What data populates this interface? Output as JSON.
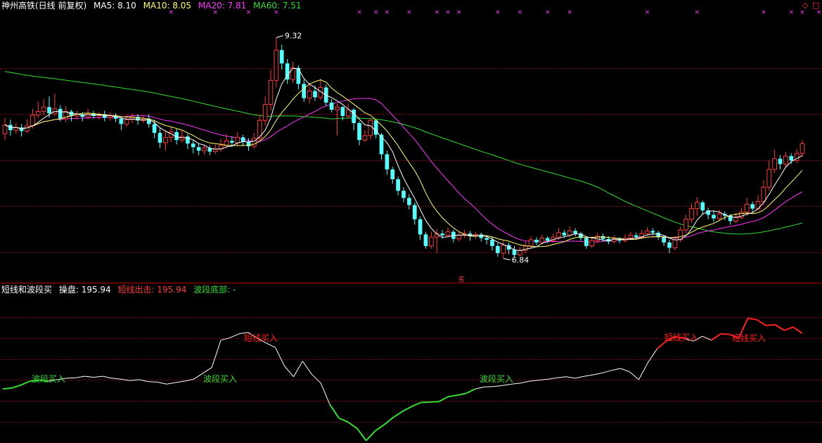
{
  "colors": {
    "bg": "#000000",
    "up": "#ff3b3b",
    "down": "#54ffff",
    "ma5": "#ffffff",
    "ma10": "#ffff66",
    "ma20": "#ff33ff",
    "ma60": "#33dd33",
    "grid": "#8b0000",
    "osc_white": "#ffffff",
    "osc_green": "#33dd33",
    "osc_red": "#ff2020",
    "star": "#ff33ff"
  },
  "header": {
    "title": "神州高铁(日线 前复权)",
    "ma5_label": "MA5: 8.10",
    "ma10_label": "MA10: 8.05",
    "ma20_label": "MA20: 7.81",
    "ma60_label": "MA60: 7.51"
  },
  "corner_icons": [
    "◇",
    "□"
  ],
  "price_annotations": {
    "high": "9.32",
    "low": "6.84",
    "marker": "名"
  },
  "indicator_header": {
    "name": "短线和波段买",
    "caopan": "操盘: 195.94",
    "duanxian_chuji": "短线出击: 195.94",
    "boduan_dibu": "波段底部: -"
  },
  "indicator_labels": {
    "wave_buy": "波段买入",
    "short_buy": "短线买入"
  },
  "chart_data": [
    {
      "type": "candlestick",
      "title": "神州高铁(日线 前复权)",
      "ylim": [
        6.6,
        9.6
      ],
      "visible_high": 9.32,
      "visible_low": 6.84,
      "x_days": 150,
      "last_ma": {
        "MA5": 8.1,
        "MA10": 8.05,
        "MA20": 7.81,
        "MA60": 7.51
      },
      "candles": [
        [
          8.24,
          8.34,
          8.42,
          8.17
        ],
        [
          8.34,
          8.28,
          8.4,
          8.22
        ],
        [
          8.28,
          8.31,
          8.36,
          8.24
        ],
        [
          8.31,
          8.27,
          8.35,
          8.21
        ],
        [
          8.27,
          8.33,
          8.4,
          8.25
        ],
        [
          8.33,
          8.45,
          8.52,
          8.3
        ],
        [
          8.45,
          8.49,
          8.6,
          8.42
        ],
        [
          8.49,
          8.54,
          8.63,
          8.45
        ],
        [
          8.54,
          8.47,
          8.66,
          8.42
        ],
        [
          8.47,
          8.52,
          8.69,
          8.44
        ],
        [
          8.52,
          8.41,
          8.56,
          8.38
        ],
        [
          8.41,
          8.49,
          8.55,
          8.37
        ],
        [
          8.49,
          8.44,
          8.51,
          8.38
        ],
        [
          8.44,
          8.46,
          8.5,
          8.4
        ],
        [
          8.46,
          8.43,
          8.48,
          8.38
        ],
        [
          8.43,
          8.47,
          8.52,
          8.4
        ],
        [
          8.47,
          8.44,
          8.5,
          8.41
        ],
        [
          8.44,
          8.46,
          8.49,
          8.4
        ],
        [
          8.46,
          8.42,
          8.5,
          8.38
        ],
        [
          8.42,
          8.44,
          8.48,
          8.39
        ],
        [
          8.44,
          8.41,
          8.47,
          8.37
        ],
        [
          8.41,
          8.35,
          8.44,
          8.28
        ],
        [
          8.35,
          8.4,
          8.45,
          8.32
        ],
        [
          8.4,
          8.43,
          8.47,
          8.36
        ],
        [
          8.43,
          8.39,
          8.46,
          8.34
        ],
        [
          8.39,
          8.41,
          8.45,
          8.36
        ],
        [
          8.41,
          8.35,
          8.46,
          8.31
        ],
        [
          8.35,
          8.25,
          8.4,
          8.19
        ],
        [
          8.25,
          8.14,
          8.3,
          8.08
        ],
        [
          8.14,
          8.2,
          8.28,
          8.05
        ],
        [
          8.2,
          8.26,
          8.32,
          8.15
        ],
        [
          8.26,
          8.17,
          8.3,
          8.12
        ],
        [
          8.17,
          8.21,
          8.28,
          8.14
        ],
        [
          8.21,
          8.13,
          8.24,
          8.07
        ],
        [
          8.13,
          8.09,
          8.17,
          8.02
        ],
        [
          8.09,
          8.05,
          8.13,
          8.0
        ],
        [
          8.05,
          8.08,
          8.12,
          8.01
        ],
        [
          8.08,
          8.04,
          8.11,
          8.0
        ],
        [
          8.04,
          8.07,
          8.12,
          8.01
        ],
        [
          8.07,
          8.11,
          8.18,
          8.04
        ],
        [
          8.11,
          8.16,
          8.24,
          8.08
        ],
        [
          8.16,
          8.14,
          8.21,
          8.09
        ],
        [
          8.14,
          8.2,
          8.26,
          8.1
        ],
        [
          8.2,
          8.15,
          8.23,
          8.1
        ],
        [
          8.15,
          8.1,
          8.19,
          8.05
        ],
        [
          8.1,
          8.19,
          8.25,
          8.07
        ],
        [
          8.19,
          8.39,
          8.45,
          8.15
        ],
        [
          8.39,
          8.57,
          8.66,
          8.33
        ],
        [
          8.57,
          8.84,
          8.96,
          8.5
        ],
        [
          8.84,
          9.18,
          9.32,
          8.76
        ],
        [
          9.18,
          9.03,
          9.24,
          8.96
        ],
        [
          9.03,
          8.85,
          9.08,
          8.8
        ],
        [
          8.85,
          8.98,
          9.05,
          8.81
        ],
        [
          8.98,
          8.8,
          9.01,
          8.74
        ],
        [
          8.8,
          8.64,
          8.85,
          8.6
        ],
        [
          8.64,
          8.72,
          8.8,
          8.58
        ],
        [
          8.72,
          8.65,
          8.78,
          8.61
        ],
        [
          8.65,
          8.76,
          8.86,
          8.62
        ],
        [
          8.76,
          8.59,
          8.79,
          8.55
        ],
        [
          8.59,
          8.51,
          8.63,
          8.48
        ],
        [
          8.51,
          8.54,
          8.58,
          8.22
        ],
        [
          8.54,
          8.44,
          8.55,
          8.39
        ],
        [
          8.44,
          8.51,
          8.58,
          8.41
        ],
        [
          8.51,
          8.36,
          8.53,
          8.28
        ],
        [
          8.36,
          8.17,
          8.38,
          8.11
        ],
        [
          8.17,
          8.22,
          8.28,
          8.15
        ],
        [
          8.22,
          8.39,
          8.42,
          8.18
        ],
        [
          8.39,
          8.23,
          8.4,
          8.19
        ],
        [
          8.23,
          8.01,
          8.25,
          7.95
        ],
        [
          8.01,
          7.84,
          8.05,
          7.78
        ],
        [
          7.84,
          7.73,
          7.87,
          7.68
        ],
        [
          7.73,
          7.6,
          7.76,
          7.55
        ],
        [
          7.6,
          7.52,
          7.64,
          7.47
        ],
        [
          7.52,
          7.44,
          7.56,
          7.39
        ],
        [
          7.44,
          7.28,
          7.47,
          7.22
        ],
        [
          7.28,
          7.11,
          7.31,
          7.05
        ],
        [
          7.11,
          6.98,
          7.14,
          6.95
        ],
        [
          6.98,
          7.08,
          7.14,
          6.95
        ],
        [
          7.08,
          7.12,
          7.17,
          6.9
        ],
        [
          7.12,
          7.1,
          7.16,
          7.06
        ],
        [
          7.1,
          7.14,
          7.19,
          7.08
        ],
        [
          7.14,
          7.06,
          7.16,
          7.02
        ],
        [
          7.06,
          7.1,
          7.14,
          7.03
        ],
        [
          7.1,
          7.12,
          7.16,
          7.07
        ],
        [
          7.12,
          7.09,
          7.15,
          7.04
        ],
        [
          7.09,
          7.11,
          7.14,
          7.06
        ],
        [
          7.11,
          7.07,
          7.13,
          7.03
        ],
        [
          7.07,
          7.05,
          7.1,
          7.0
        ],
        [
          7.05,
          6.98,
          7.08,
          6.93
        ],
        [
          6.98,
          6.9,
          7.01,
          6.86
        ],
        [
          6.9,
          6.99,
          7.04,
          6.84
        ],
        [
          6.99,
          6.94,
          7.02,
          6.89
        ],
        [
          6.94,
          6.88,
          6.98,
          6.85
        ],
        [
          6.88,
          6.93,
          6.97,
          6.86
        ],
        [
          6.93,
          6.98,
          7.03,
          6.9
        ],
        [
          6.98,
          7.05,
          7.09,
          6.95
        ],
        [
          7.05,
          7.02,
          7.08,
          6.99
        ],
        [
          7.02,
          7.07,
          7.11,
          7.0
        ],
        [
          7.07,
          7.04,
          7.09,
          7.01
        ],
        [
          7.04,
          7.08,
          7.12,
          7.02
        ],
        [
          7.08,
          7.13,
          7.18,
          7.05
        ],
        [
          7.13,
          7.1,
          7.16,
          7.07
        ],
        [
          7.1,
          7.15,
          7.2,
          7.08
        ],
        [
          7.15,
          7.12,
          7.18,
          7.09
        ],
        [
          7.12,
          7.07,
          7.14,
          7.04
        ],
        [
          7.07,
          6.98,
          7.09,
          6.95
        ],
        [
          6.98,
          7.04,
          7.08,
          6.96
        ],
        [
          7.04,
          7.09,
          7.13,
          7.01
        ],
        [
          7.09,
          7.06,
          7.12,
          7.03
        ],
        [
          7.06,
          7.03,
          7.09,
          7.0
        ],
        [
          7.03,
          7.06,
          7.1,
          7.01
        ],
        [
          7.06,
          7.04,
          7.08,
          7.01
        ],
        [
          7.04,
          7.07,
          7.11,
          7.02
        ],
        [
          7.07,
          7.1,
          7.14,
          7.05
        ],
        [
          7.1,
          7.08,
          7.13,
          7.05
        ],
        [
          7.08,
          7.12,
          7.16,
          7.06
        ],
        [
          7.12,
          7.15,
          7.19,
          7.1
        ],
        [
          7.15,
          7.13,
          7.18,
          7.1
        ],
        [
          7.13,
          7.08,
          7.15,
          7.05
        ],
        [
          7.08,
          7.02,
          7.1,
          6.98
        ],
        [
          7.02,
          6.96,
          7.05,
          6.9
        ],
        [
          6.96,
          7.05,
          7.09,
          6.93
        ],
        [
          7.05,
          7.16,
          7.2,
          7.02
        ],
        [
          7.16,
          7.28,
          7.33,
          7.12
        ],
        [
          7.28,
          7.4,
          7.46,
          7.24
        ],
        [
          7.4,
          7.47,
          7.53,
          7.32
        ],
        [
          7.47,
          7.38,
          7.49,
          7.33
        ],
        [
          7.38,
          7.33,
          7.41,
          7.28
        ],
        [
          7.33,
          7.29,
          7.37,
          7.25
        ],
        [
          7.29,
          7.34,
          7.39,
          7.26
        ],
        [
          7.34,
          7.32,
          7.37,
          7.27
        ],
        [
          7.32,
          7.26,
          7.34,
          7.22
        ],
        [
          7.26,
          7.3,
          7.35,
          7.24
        ],
        [
          7.3,
          7.36,
          7.41,
          7.28
        ],
        [
          7.36,
          7.45,
          7.52,
          7.32
        ],
        [
          7.45,
          7.4,
          7.48,
          7.36
        ],
        [
          7.4,
          7.48,
          7.55,
          7.38
        ],
        [
          7.48,
          7.64,
          7.72,
          7.44
        ],
        [
          7.64,
          7.84,
          7.94,
          7.6
        ],
        [
          7.84,
          7.96,
          8.06,
          7.8
        ],
        [
          7.96,
          7.9,
          8.0,
          7.84
        ],
        [
          7.9,
          7.99,
          8.04,
          7.86
        ],
        [
          7.99,
          7.94,
          8.02,
          7.9
        ],
        [
          7.94,
          8.02,
          8.07,
          7.91
        ],
        [
          8.02,
          8.13,
          8.17,
          7.98
        ]
      ]
    },
    {
      "type": "line",
      "title": "短线和波段买",
      "ylim": [
        0,
        300
      ],
      "series": [
        {
          "name": "操盘",
          "last": 195.94
        }
      ],
      "points": [
        [
          0,
          108
        ],
        [
          2,
          110
        ],
        [
          4,
          116
        ],
        [
          6,
          124
        ],
        [
          8,
          126
        ],
        [
          10,
          124
        ],
        [
          12,
          127
        ],
        [
          14,
          130
        ],
        [
          16,
          131
        ],
        [
          18,
          134
        ],
        [
          20,
          132
        ],
        [
          22,
          134
        ],
        [
          24,
          130
        ],
        [
          26,
          128
        ],
        [
          28,
          125
        ],
        [
          30,
          127
        ],
        [
          32,
          123
        ],
        [
          34,
          122
        ],
        [
          36,
          118
        ],
        [
          38,
          121
        ],
        [
          40,
          124
        ],
        [
          42,
          128
        ],
        [
          44,
          140
        ],
        [
          46,
          152
        ],
        [
          48,
          208
        ],
        [
          50,
          213
        ],
        [
          52,
          221
        ],
        [
          54,
          224
        ],
        [
          56,
          212
        ],
        [
          58,
          202
        ],
        [
          60,
          193
        ],
        [
          62,
          155
        ],
        [
          64,
          133
        ],
        [
          66,
          165
        ],
        [
          68,
          138
        ],
        [
          70,
          120
        ],
        [
          72,
          76
        ],
        [
          74,
          48
        ],
        [
          76,
          40
        ],
        [
          78,
          27
        ],
        [
          80,
          2
        ],
        [
          82,
          22
        ],
        [
          84,
          35
        ],
        [
          86,
          50
        ],
        [
          88,
          62
        ],
        [
          90,
          72
        ],
        [
          92,
          80
        ],
        [
          94,
          81
        ],
        [
          96,
          82
        ],
        [
          98,
          92
        ],
        [
          100,
          95
        ],
        [
          102,
          99
        ],
        [
          104,
          108
        ],
        [
          106,
          112
        ],
        [
          108,
          113
        ],
        [
          110,
          115
        ],
        [
          112,
          118
        ],
        [
          114,
          120
        ],
        [
          116,
          124
        ],
        [
          118,
          126
        ],
        [
          120,
          128
        ],
        [
          122,
          131
        ],
        [
          124,
          133
        ],
        [
          126,
          130
        ],
        [
          128,
          134
        ],
        [
          130,
          137
        ],
        [
          132,
          141
        ],
        [
          134,
          146
        ],
        [
          136,
          150
        ],
        [
          138,
          143
        ],
        [
          140,
          127
        ],
        [
          142,
          162
        ],
        [
          144,
          190
        ],
        [
          146,
          206
        ],
        [
          148,
          215
        ],
        [
          150,
          212
        ],
        [
          152,
          206
        ],
        [
          154,
          216
        ],
        [
          156,
          208
        ],
        [
          158,
          221
        ],
        [
          160,
          220
        ],
        [
          162,
          212
        ],
        [
          164,
          253
        ],
        [
          166,
          250
        ],
        [
          168,
          238
        ],
        [
          170,
          240
        ],
        [
          172,
          228
        ],
        [
          174,
          235
        ],
        [
          176,
          222
        ]
      ]
    }
  ]
}
